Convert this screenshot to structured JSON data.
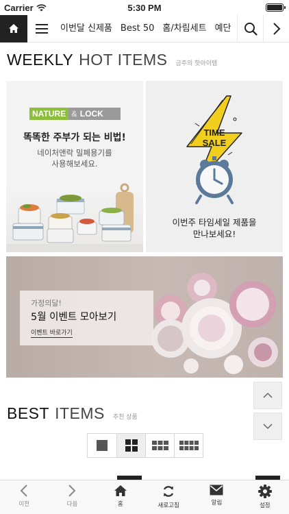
{
  "status_bar": {
    "carrier": "Carrier",
    "time": "5:30 PM"
  },
  "nav": {
    "items": [
      "이번달 신제품",
      "Best 50",
      "홈/차림세트",
      "예단"
    ]
  },
  "weekly": {
    "title_strong": "WEEKLY",
    "title_light": "HOT ITEMS",
    "subtitle": "금주의 핫아이템"
  },
  "banner_left": {
    "logo_part1": "NATURE",
    "logo_amp": "&",
    "logo_part2": "LOCK",
    "heading": "똑똑한 주부가 되는 비법!",
    "sub_line1": "네이처앤락 밀폐용기를",
    "sub_line2": "사용해보세요."
  },
  "banner_right": {
    "badge_line1": "TIME",
    "badge_line2": "SALE",
    "caption_line1": "이번주 타임세일 제품을",
    "caption_line2": "만나보세요!"
  },
  "banner_event": {
    "pre": "가정의달!",
    "main": "5월 이벤트 모아보기",
    "link": "이벤트 바로가기"
  },
  "best": {
    "title_strong": "BEST",
    "title_light": "ITEMS",
    "subtitle": "추천 상품"
  },
  "view_options": [
    "single-view",
    "grid-2",
    "grid-3",
    "grid-4"
  ],
  "active_view": "grid-2",
  "tabbar": {
    "items": [
      {
        "label": "이전",
        "icon": "chevron-left-icon",
        "enabled": false
      },
      {
        "label": "다음",
        "icon": "chevron-right-icon",
        "enabled": false
      },
      {
        "label": "홈",
        "icon": "home-icon",
        "enabled": true
      },
      {
        "label": "새로고침",
        "icon": "refresh-icon",
        "enabled": true
      },
      {
        "label": "알림",
        "icon": "mail-icon",
        "enabled": true
      },
      {
        "label": "설정",
        "icon": "gear-icon",
        "enabled": true
      }
    ]
  },
  "colors": {
    "accent_yellow": "#f2cf1f",
    "clock_blue": "#5b7a9a",
    "nature_green": "#8bbf3a"
  }
}
